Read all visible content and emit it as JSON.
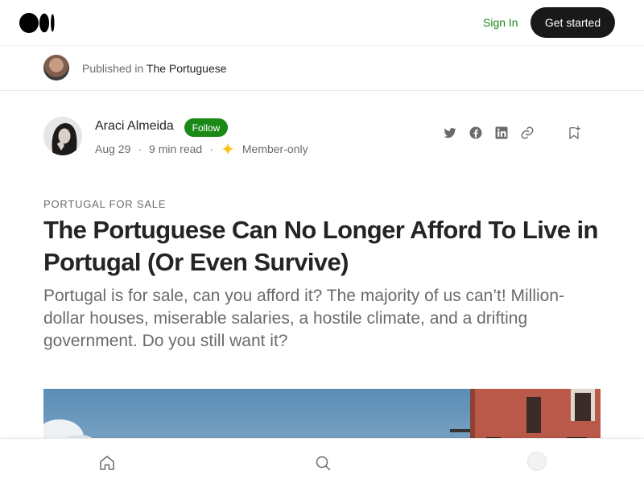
{
  "header": {
    "logo_icon": "medium-logo-icon",
    "signin_label": "Sign In",
    "getstarted_label": "Get started",
    "accent_color": "#1a8917"
  },
  "publication": {
    "prefix": "Published in",
    "name": "The Portuguese"
  },
  "author": {
    "name": "Araci Almeida",
    "follow_label": "Follow",
    "date": "Aug 29",
    "read_time": "9 min read",
    "membership": "Member-only"
  },
  "share_icons": [
    "twitter-icon",
    "facebook-icon",
    "linkedin-icon",
    "link-icon"
  ],
  "article": {
    "kicker": "PORTUGAL FOR SALE",
    "title": "The Portuguese Can No Longer Afford To Live in Portugal (Or Even Survive)",
    "subtitle": "Portugal is for sale, can you afford it? The majority of us can’t! Million-dollar houses, miserable salaries, a hostile climate, and a drifting government. Do you still want it?"
  },
  "bottom_nav": [
    "home-icon",
    "search-icon",
    "avatar"
  ]
}
